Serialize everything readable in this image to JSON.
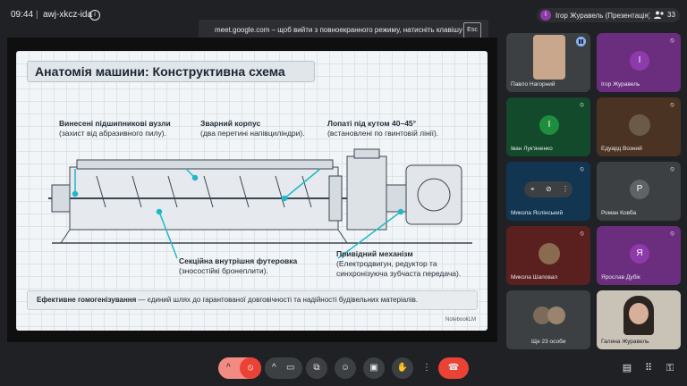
{
  "topbar": {
    "time": "09:44",
    "separator": "|",
    "meeting_code": "awj-xkcz-ida",
    "info_icon": "i"
  },
  "toast": {
    "text": "meet.google.com – щоб вийти з повноекранного режиму, натисніть клавішу",
    "key": "Esc"
  },
  "presenter": {
    "avatar_letter": "І",
    "label": "Ігор Журавель (Презентація)"
  },
  "participants_count": "33",
  "slide": {
    "title": "Анатомія машини: Конструктивна схема",
    "labels": [
      {
        "title": "Винесені підшипникові вузли",
        "sub": "(захист від абразивного пилу)."
      },
      {
        "title": "Зварний корпус",
        "sub": "(два перетині напівциліндри)."
      },
      {
        "title": "Лопаті під кутом 40–45°",
        "sub": "(встановлені по гвинтовій лінії)."
      },
      {
        "title": "Секційна внутрішня футеровка",
        "sub": "(зносостійкі бронеплити)."
      },
      {
        "title": "Привідний механізм",
        "sub": "(Електродвигун, редуктор та",
        "sub2": "синхронізуюча зубчаста передача)."
      }
    ],
    "footer_bold": "Ефективне гомогенізування",
    "footer_rest": " — єдиний шлях до гарантованої довговічності та надійності будівельних матеріалів.",
    "watermark": "NotebookLM"
  },
  "tiles": [
    {
      "name": "Павло Нагорний",
      "avatar": "",
      "color": "#3c4043",
      "speaking": true
    },
    {
      "name": "Ігор Журавель",
      "avatar": "І",
      "color": "#8e3aaa"
    },
    {
      "name": "Іван Лук'яненко",
      "avatar": "І",
      "color": "#1e8e3e"
    },
    {
      "name": "Едуард Возний",
      "avatar": "",
      "color": "#7a4f28"
    },
    {
      "name": "Микола Яслінський",
      "avatar": "",
      "color": "#1a3a5c"
    },
    {
      "name": "Роман Ковба",
      "avatar": "Р",
      "color": "#5f6368"
    },
    {
      "name": "Микола Шаповал",
      "avatar": "",
      "color": "#7a2323"
    },
    {
      "name": "Ярослав Дубік",
      "avatar": "Я",
      "color": "#8e3aaa"
    },
    {
      "name": "Ще 23 особи",
      "avatar": "",
      "color": "#3c4043"
    },
    {
      "name": "Галина Журавель",
      "avatar": "",
      "color": "#c9c2b6"
    }
  ],
  "controls": {
    "chevron": "^",
    "more": "⋮"
  }
}
